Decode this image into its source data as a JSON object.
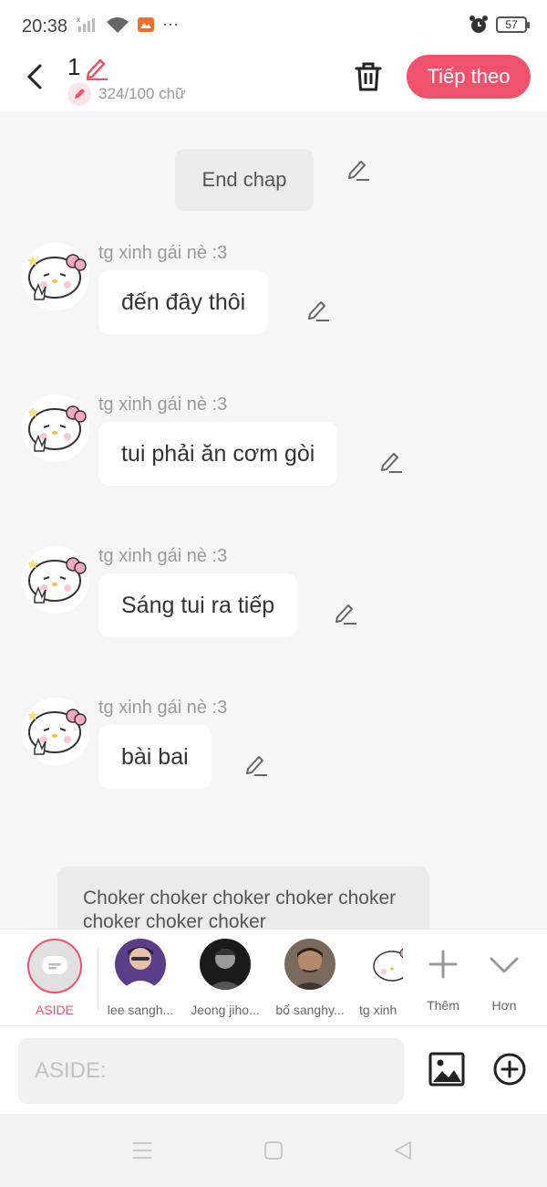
{
  "status": {
    "time": "20:38",
    "battery": "57"
  },
  "header": {
    "title": "1",
    "word_count": "324/100 chữ",
    "next_label": "Tiếp theo"
  },
  "chat": {
    "end_chap": "End chap",
    "messages": [
      {
        "sender": "tg xinh gái nè :3",
        "text": "đến đây thôi"
      },
      {
        "sender": "tg xinh gái nè :3",
        "text": "tui phải ăn cơm gòi"
      },
      {
        "sender": "tg xinh gái nè :3",
        "text": "Sáng tui ra tiếp"
      },
      {
        "sender": "tg xinh gái nè :3",
        "text": "bài bai"
      }
    ],
    "aside_preview": "Choker choker choker choker choker choker choker choker"
  },
  "characters": {
    "aside": "ASIDE",
    "items": [
      {
        "label": "lee sangh..."
      },
      {
        "label": "Jeong jiho..."
      },
      {
        "label": "bố sanghy..."
      },
      {
        "label": "tg xinh"
      }
    ],
    "add": "Thêm",
    "more": "Hơn"
  },
  "input": {
    "placeholder": "ASIDE:"
  },
  "colors": {
    "accent": "#f1526b",
    "background": "#f6f6f6"
  }
}
